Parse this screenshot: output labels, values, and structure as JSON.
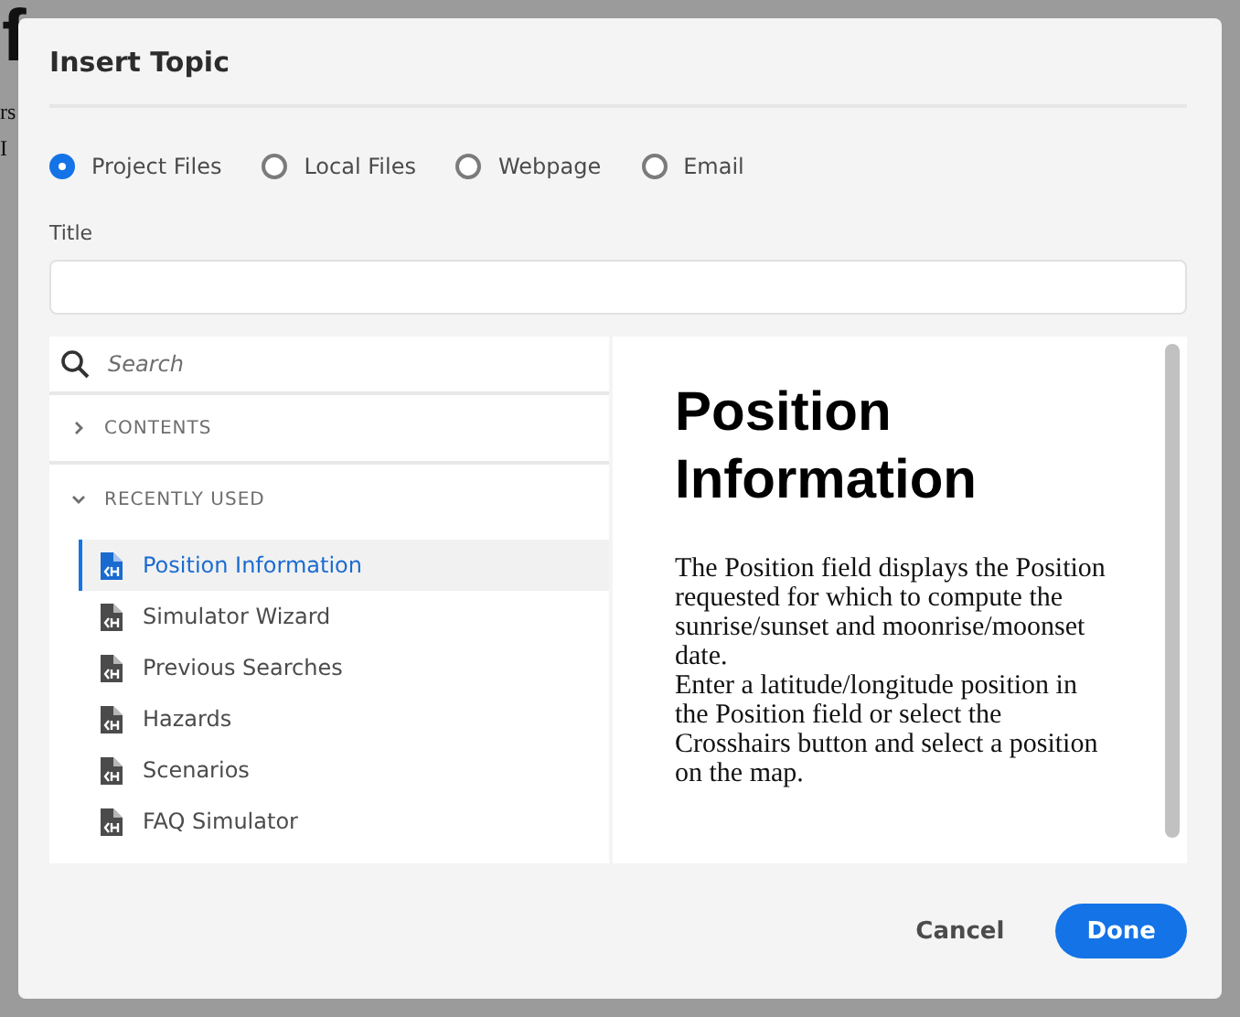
{
  "background": {
    "heading": "f",
    "lines": [
      "rs",
      "I"
    ]
  },
  "dialog": {
    "title": "Insert Topic",
    "source_options": [
      {
        "label": "Project Files",
        "selected": true
      },
      {
        "label": "Local Files",
        "selected": false
      },
      {
        "label": "Webpage",
        "selected": false
      },
      {
        "label": "Email",
        "selected": false
      }
    ],
    "title_field": {
      "label": "Title"
    },
    "search": {
      "placeholder": "Search"
    },
    "sections": [
      {
        "label": "CONTENTS",
        "expanded": false
      },
      {
        "label": "RECENTLY USED",
        "expanded": true,
        "children": [
          {
            "label": "Position Information",
            "selected": true
          },
          {
            "label": "Simulator Wizard",
            "selected": false
          },
          {
            "label": "Previous Searches",
            "selected": false
          },
          {
            "label": "Hazards",
            "selected": false
          },
          {
            "label": "Scenarios",
            "selected": false
          },
          {
            "label": "FAQ Simulator",
            "selected": false
          }
        ]
      }
    ],
    "preview": {
      "heading": "Position Information",
      "paragraphs": [
        "The Position field displays the Position requested for which to compute the sunrise/sunset and moonrise/moonset date.",
        "Enter a latitude/longitude position in the Position field or select the Crosshairs button and select a position on the map."
      ]
    },
    "buttons": [
      {
        "label": "Cancel",
        "kind": "secondary"
      },
      {
        "label": "Done",
        "kind": "primary"
      }
    ]
  }
}
